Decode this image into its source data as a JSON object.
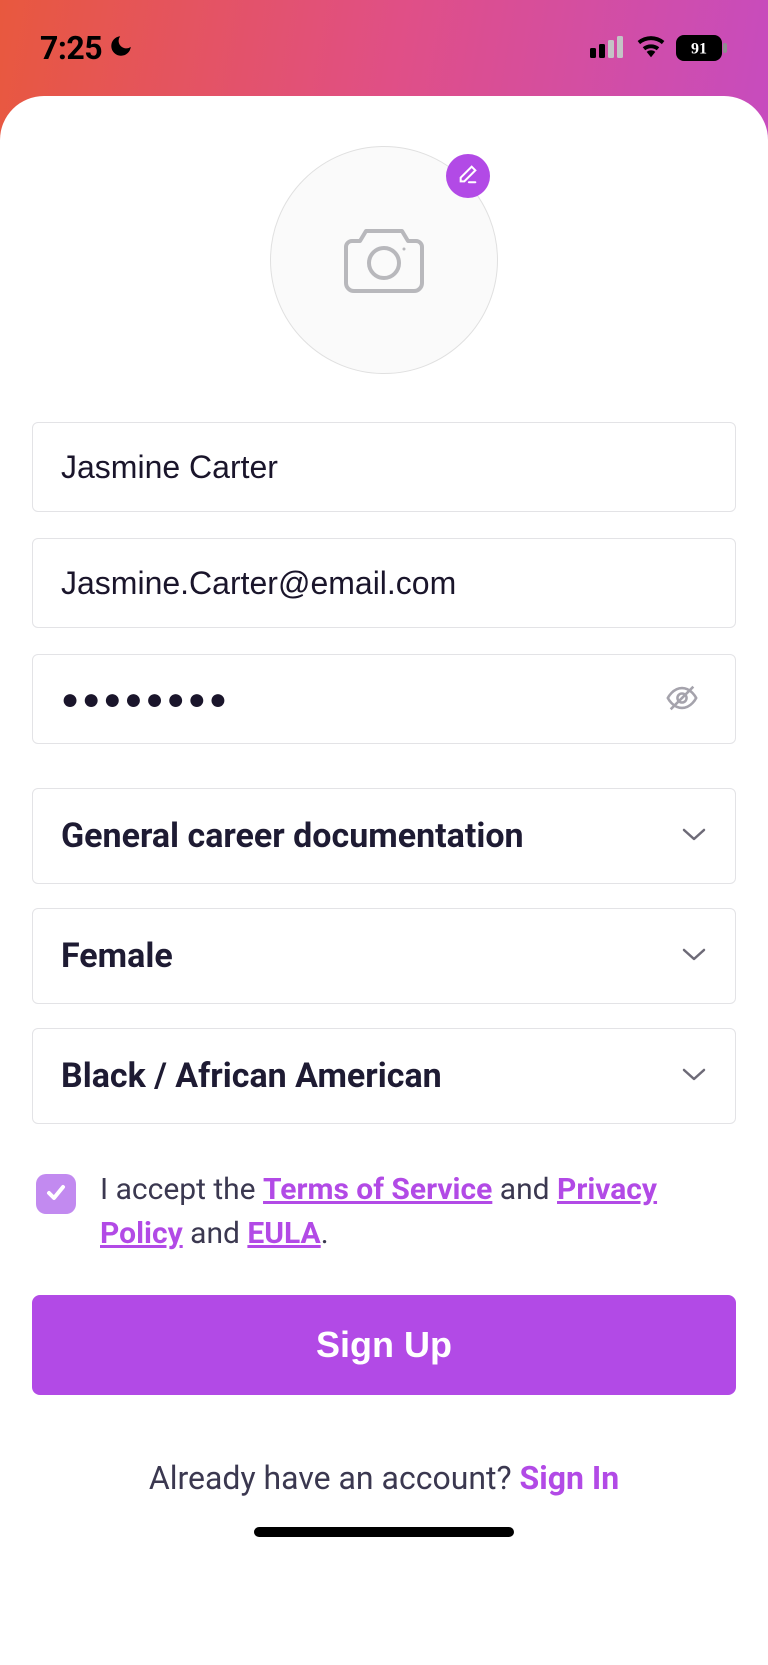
{
  "status": {
    "time": "7:25",
    "battery": "91"
  },
  "form": {
    "name": "Jasmine Carter",
    "email": "Jasmine.Carter@email.com",
    "password_mask": "●●●●●●●●",
    "career": "General career documentation",
    "gender": "Female",
    "ethnicity": "Black / African American"
  },
  "terms": {
    "prefix": "I accept the ",
    "tos": "Terms of Service",
    "and1": " and ",
    "privacy": "Privacy Policy",
    "and2": " and ",
    "eula": "EULA",
    "period": "."
  },
  "actions": {
    "signup": "Sign Up",
    "already": "Already have an account? ",
    "signin": "Sign In"
  }
}
